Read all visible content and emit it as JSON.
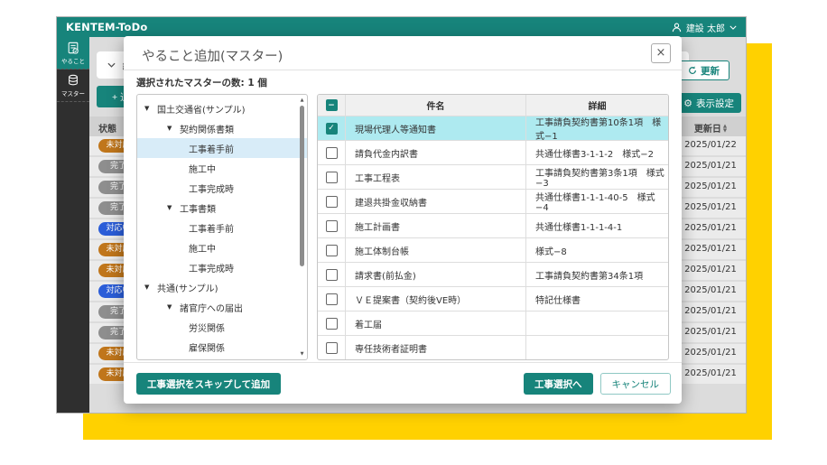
{
  "app": {
    "logo": "KENTEM-ToDo",
    "user": "建設 太郎",
    "sidebar": {
      "todo": "やること",
      "master": "マスター"
    },
    "filter_label": "絞り込み",
    "add_label": "+ 追加",
    "refresh_label": "更新",
    "settings_label": "表示設定",
    "status_header": "状態",
    "date_header": "更新日",
    "rows": [
      {
        "status": "未対応",
        "cls": "orange",
        "date": "2025/01/22"
      },
      {
        "status": "完了",
        "cls": "gray",
        "date": "2025/01/21"
      },
      {
        "status": "完了",
        "cls": "gray",
        "date": "2025/01/21"
      },
      {
        "status": "完了",
        "cls": "gray",
        "date": "2025/01/21"
      },
      {
        "status": "対応中",
        "cls": "blue",
        "date": "2025/01/21"
      },
      {
        "status": "未対応",
        "cls": "orange",
        "date": "2025/01/21"
      },
      {
        "status": "未対応",
        "cls": "orange",
        "date": "2025/01/21"
      },
      {
        "status": "対応中",
        "cls": "blue",
        "date": "2025/01/21"
      },
      {
        "status": "完了",
        "cls": "gray",
        "date": "2025/01/21"
      },
      {
        "status": "完了",
        "cls": "gray",
        "date": "2025/01/21"
      },
      {
        "status": "未対応",
        "cls": "orange",
        "date": "2025/01/21"
      },
      {
        "status": "未対応",
        "cls": "orange",
        "date": "2025/01/21"
      }
    ]
  },
  "modal": {
    "title": "やること追加(マスター)",
    "close": "×",
    "selected_count": "選択されたマスターの数: 1 個",
    "tree": [
      {
        "label": "国土交通省(サンプル)",
        "arrow": "▼",
        "cls": "lv0"
      },
      {
        "label": "契約関係書類",
        "arrow": "▼",
        "cls": "lv1"
      },
      {
        "label": "工事着手前",
        "arrow": "",
        "cls": "lv2 sel"
      },
      {
        "label": "施工中",
        "arrow": "",
        "cls": "lv2"
      },
      {
        "label": "工事完成時",
        "arrow": "",
        "cls": "lv2"
      },
      {
        "label": "工事書類",
        "arrow": "▼",
        "cls": "lv1"
      },
      {
        "label": "工事着手前",
        "arrow": "",
        "cls": "lv2"
      },
      {
        "label": "施工中",
        "arrow": "",
        "cls": "lv2"
      },
      {
        "label": "工事完成時",
        "arrow": "",
        "cls": "lv2"
      },
      {
        "label": "共通(サンプル)",
        "arrow": "▼",
        "cls": "lv0"
      },
      {
        "label": "諸官庁への届出",
        "arrow": "▼",
        "cls": "lv1"
      },
      {
        "label": "労災関係",
        "arrow": "",
        "cls": "lv2"
      },
      {
        "label": "雇保関係",
        "arrow": "",
        "cls": "lv2"
      }
    ],
    "table": {
      "header_mark": "−",
      "col_subject": "件名",
      "col_detail": "詳細",
      "rows": [
        {
          "box": "on",
          "mark": "✓",
          "cls": "sel",
          "subject": "現場代理人等通知書",
          "detail": "工事請負契約書第10条1項　様式−1"
        },
        {
          "box": "off",
          "mark": "",
          "cls": "",
          "subject": "請負代金内訳書",
          "detail": "共通仕様書3-1-1-2　様式−2"
        },
        {
          "box": "off",
          "mark": "",
          "cls": "",
          "subject": "工事工程表",
          "detail": "工事請負契約書第3条1項　様式−3"
        },
        {
          "box": "off",
          "mark": "",
          "cls": "",
          "subject": "建退共掛金収納書",
          "detail": "共通仕様書1-1-1-40-5　様式−4"
        },
        {
          "box": "off",
          "mark": "",
          "cls": "",
          "subject": "施工計画書",
          "detail": "共通仕様書1-1-1-4-1"
        },
        {
          "box": "off",
          "mark": "",
          "cls": "",
          "subject": "施工体制台帳",
          "detail": "様式−8"
        },
        {
          "box": "off",
          "mark": "",
          "cls": "",
          "subject": "請求書(前払金)",
          "detail": "工事請負契約書第34条1項"
        },
        {
          "box": "off",
          "mark": "",
          "cls": "",
          "subject": "ＶＥ提案書（契約後VE時）",
          "detail": "特記仕様書"
        },
        {
          "box": "off",
          "mark": "",
          "cls": "",
          "subject": "着工届",
          "detail": ""
        },
        {
          "box": "off",
          "mark": "",
          "cls": "",
          "subject": "専任技術者証明書",
          "detail": ""
        }
      ]
    },
    "footer": {
      "skip": "工事選択をスキップして追加",
      "to_select": "工事選択へ",
      "cancel": "キャンセル"
    }
  },
  "colors": {
    "teal": "#17847B",
    "yellow": "#FFD100",
    "badge_orange": "#C0761B",
    "badge_gray": "#8E8E8E",
    "badge_blue": "#2B5DD8",
    "selected_row": "#aeeaf0",
    "tree_selected": "#d8ecf8"
  }
}
